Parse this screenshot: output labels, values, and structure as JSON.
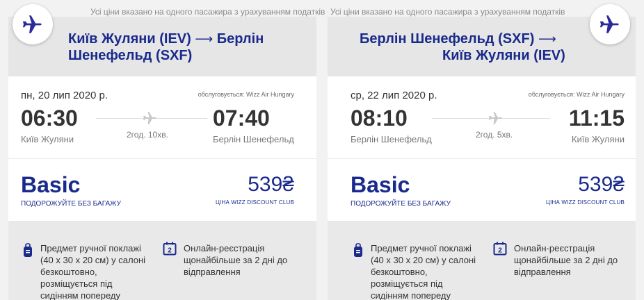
{
  "tax_note": "Усі ціни вказано на одного пасажира з урахуванням податків",
  "outbound": {
    "route_line1": "Київ Жуляни (IEV)",
    "arrow": "⟶",
    "route_line1b": "Берлін",
    "route_line2": "Шенефельд (SXF)",
    "date": "пн, 20 лип 2020 р.",
    "operated_by": "обслуговується: Wizz Air Hungary",
    "dep_time": "06:30",
    "arr_time": "07:40",
    "dep_city": "Київ Жуляни",
    "arr_city": "Берлін Шенефельд",
    "duration": "2год. 10хв.",
    "fare_name": "Basic",
    "fare_tagline": "ПОДОРОЖУЙТЕ БЕЗ БАГАЖУ",
    "price": "539₴",
    "price_note": "ЦІНА WIZZ DISCOUNT CLUB",
    "feature1": [
      "Предмет ручної поклажі",
      "(40 х 30 х 20 см) у салоні",
      "безкоштовно,",
      "розміщується під",
      "сидінням попереду"
    ],
    "feature2": [
      "Онлайн-реєстрація",
      "щонайбільше за 2 дні до",
      "відправлення"
    ],
    "calendar_digit": "2"
  },
  "return": {
    "route_line1": "Берлін Шенефельд (SXF)",
    "arrow": "⟶",
    "route_line2": "Київ Жуляни (IEV)",
    "date": "ср, 22 лип 2020 р.",
    "operated_by": "обслуговується: Wizz Air Hungary",
    "dep_time": "08:10",
    "arr_time": "11:15",
    "dep_city": "Берлін Шенефельд",
    "arr_city": "Київ Жуляни",
    "duration": "2год. 5хв.",
    "fare_name": "Basic",
    "fare_tagline": "ПОДОРОЖУЙТЕ БЕЗ БАГАЖУ",
    "price": "539₴",
    "price_note": "ЦІНА WIZZ DISCOUNT CLUB",
    "feature1": [
      "Предмет ручної поклажі",
      "(40 х 30 х 20 см) у салоні",
      "безкоштовно,",
      "розміщується під",
      "сидінням попереду"
    ],
    "feature2": [
      "Онлайн-реєстрація",
      "щонайбільше за 2 дні до",
      "відправлення"
    ],
    "calendar_digit": "2"
  },
  "colors": {
    "brand": "#1a2a8c",
    "plane_badge": "#2a2a9a"
  },
  "icons": {
    "airline_badge": "airplane-icon",
    "mid": "airplane-icon",
    "bag": "hand-luggage-icon",
    "checkin": "calendar-icon"
  }
}
